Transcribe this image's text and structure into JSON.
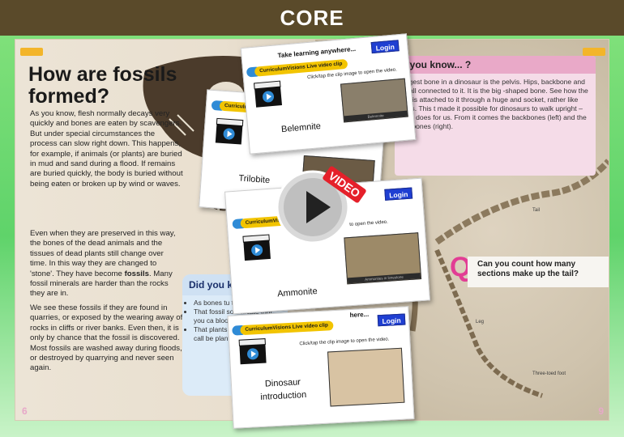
{
  "header": {
    "title": "CORE"
  },
  "left_page": {
    "heading_line1": "How are fossils",
    "heading_line2": "formed?",
    "p1": "As you know, flesh normally decays very quickly and bones are eaten by scavengers. But under special circumstances the process can slow right down. This happens, for example, if animals (or plants) are buried in mud and sand during a flood. If remains are buried quickly, the body is buried without being eaten or broken up by wind or waves.",
    "p2_start": "Even when they are preserved in this way, the bones of the dead animals and the tissues of dead plants still change over time. In this way they are changed to 'stone'. They have become",
    "p2_bold": "fossils",
    "p2_end": ". Many fossil minerals are harder than the rocks they are in.",
    "p3": "We see these fossils if they are found in quarries, or exposed by the wearing away of rocks in cliffs or river banks. Even then, it is only by chance that the fossil is discovered. Most fossils are washed away during floods, or destroyed by quarrying and never seen again.",
    "dyk_heading": "Did you kn",
    "dyk_items": [
      "As bones tu they becom",
      "That fossil so delicate that you ca blood vess",
      "That plants change int we call be plants coa"
    ],
    "page_number": "6"
  },
  "right_page": {
    "dyk_heading": "d you know... ?",
    "dyk_text": "largest bone in a dinosaur is the pelvis. Hips, backbone and re all connected to it. It is the big -shaped bone. See how the leg is attached to it through a huge and socket, rather like ours. This t made it possible for dinosaurs to walk upright – as it does for us. From it comes the backbones (left) and the tail bones (right).",
    "labels": {
      "tail": "Tail",
      "leg": "Leg",
      "foot": "Three-toed foot"
    },
    "question_letter": "Q",
    "question": "Can you count how many sections make up the tail?",
    "page_number": "9"
  },
  "cards": {
    "belemnite": {
      "heading": "Take learning anywhere...",
      "login": "Login",
      "logo": "CurriculumVisions Live video clip",
      "note": "Click/tap the clip image to open the video.",
      "title": "Belemnite",
      "caption": "Belemnite"
    },
    "trilobite": {
      "logo": "CurriculumVi",
      "title": "Trilobite"
    },
    "ammonite": {
      "login": "Login",
      "logo": "CurriculumVisi",
      "note": "to open the video.",
      "title": "Ammonite",
      "caption": "Ammonites in limestone"
    },
    "dinosaur": {
      "heading": "here...",
      "login": "Login",
      "logo": "CurriculumVisions Live video clip",
      "note": "Click/tap the clip image to open the video.",
      "title_line1": "Dinosaur",
      "title_line2": "introduction"
    }
  },
  "overlay": {
    "video_tag": "VIDEO"
  },
  "colors": {
    "header_bg": "#5a4a2a",
    "frame_green": "#5fd36a",
    "login_blue": "#1f3fd2",
    "video_red": "#e5202a",
    "q_pink": "#e23d94"
  }
}
